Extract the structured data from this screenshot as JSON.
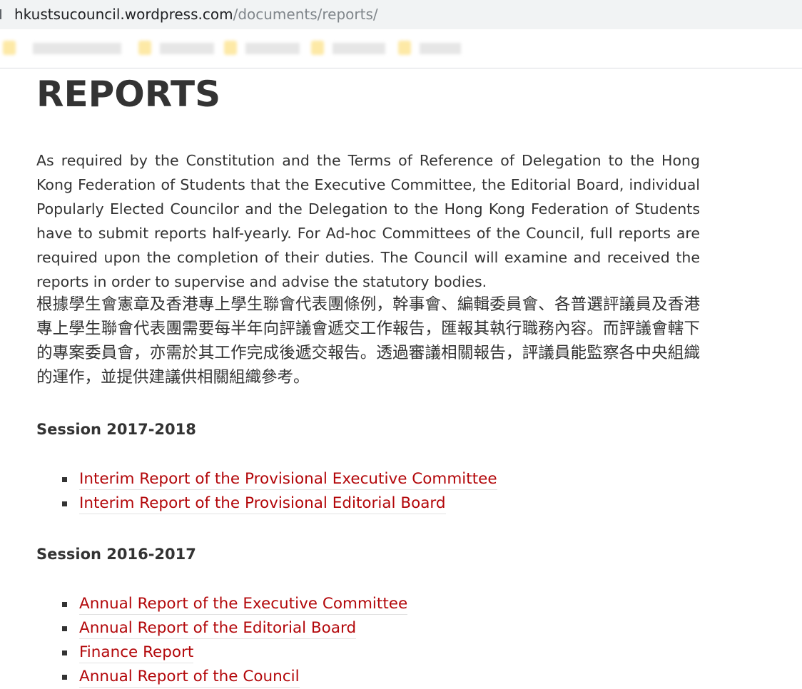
{
  "browser": {
    "url_host": "hkustsucouncil.wordpress.com",
    "url_path": "/documents/reports/"
  },
  "page": {
    "title": "REPORTS",
    "intro_en": "As required by the Constitution and the Terms of Reference of Delegation to the Hong Kong Federation of Students that the Executive Committee, the Editorial Board, individual Popularly Elected Councilor and the Delegation to the Hong Kong Federation of Students have to submit reports half-yearly. For Ad-hoc Committees of the Council, full reports are required upon the completion of their duties. The Council will examine and received the reports in order to supervise and advise the statutory bodies.",
    "intro_zh": "根據學生會憲章及香港專上學生聯會代表團條例，幹事會、編輯委員會、各普選評議員及香港專上學生聯會代表團需要每半年向評議會遞交工作報告，匯報其執行職務內容。而評議會轄下的專案委員會，亦需於其工作完成後遞交報告。透過審議相關報告，評議員能監察各中央組織的運作，並提供建議供相關組織參考。"
  },
  "sessions": [
    {
      "title": "Session 2017-2018",
      "reports": [
        "Interim Report of the Provisional Executive Committee",
        "Interim Report of the Provisional Editorial Board"
      ]
    },
    {
      "title": "Session 2016-2017",
      "reports": [
        "Annual Report of the Executive Committee",
        "Annual Report of the Editorial Board",
        "Finance Report",
        "Annual Report of the Council"
      ]
    }
  ],
  "colors": {
    "link": "#b3070a",
    "text": "#333333"
  }
}
